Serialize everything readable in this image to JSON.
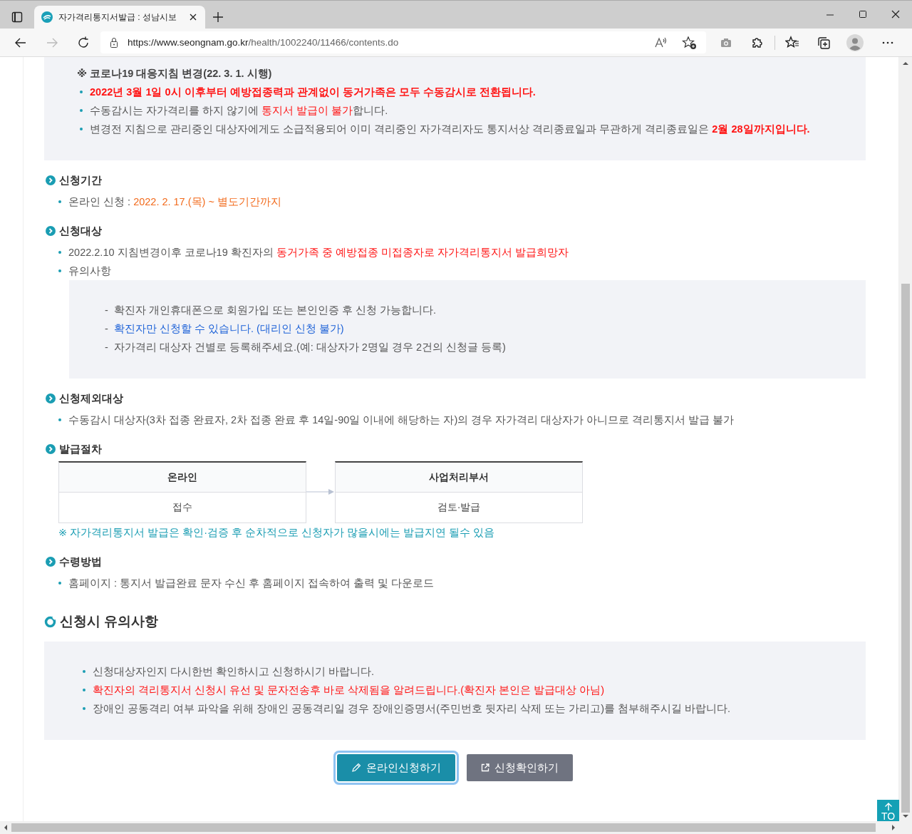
{
  "browser": {
    "tab_title": "자가격리통지서발급 : 성남시보",
    "url_host": "https://www.seongnam.go.kr",
    "url_path": "/health/1002240/11466/contents.do"
  },
  "notice": {
    "title": "※ 코로나19 대응지침 변경(22. 3. 1. 시행)",
    "items": [
      {
        "kind": "strong",
        "segments": [
          {
            "text": "2022년 3월 1일 0시 이후부터 예방접종력과 관계없이 동거가족은 모두 수동감시로 전환됩니다.",
            "color": "#ff1414"
          }
        ]
      },
      {
        "kind": "normal",
        "segments": [
          {
            "text": "수동감시는 자가격리를 하지 않기에 ",
            "color": "#555555"
          },
          {
            "text": "통지서 발급이 불가",
            "color": "#ff1414"
          },
          {
            "text": "합니다.",
            "color": "#555555"
          }
        ]
      },
      {
        "kind": "normal",
        "segments": [
          {
            "text": "변경전 지침으로 관리중인 대상자에게도 소급적용되어 이미 격리중인 자가격리자도 통지서상 격리종료일과 무관하게 격리종료일은 ",
            "color": "#555555"
          },
          {
            "text": "**2월 28일까지입니다.**",
            "color": "#ff1414"
          }
        ]
      }
    ]
  },
  "sections": [
    {
      "title": "신청기간",
      "body": [
        {
          "kind": "bullet",
          "segments": [
            {
              "text": "온라인 신청 : ",
              "color": "#555555"
            },
            {
              "text": "2022. 2. 17.(목) ~ 별도기간까지",
              "color": "#f26b1d"
            }
          ]
        }
      ]
    },
    {
      "title": "신청대상",
      "body": [
        {
          "kind": "bullet",
          "segments": [
            {
              "text": "2022.2.10 지침변경이후 코로나19 확진자의 ",
              "color": "#555555"
            },
            {
              "text": "동거가족 중 예방접종 미접종자로 자가격리통지서 발급희망자",
              "color": "#ff1414"
            }
          ]
        },
        {
          "kind": "bullet",
          "segments": [
            {
              "text": "유의사항",
              "color": "#555555"
            }
          ]
        },
        {
          "kind": "note_box",
          "lines": [
            {
              "marker": "-",
              "text": "확진자 개인휴대폰으로 회원가입 또는 본인인증 후 신청 가능합니다.",
              "color": "#555555"
            },
            {
              "marker": "-",
              "text": "확진자만 신청할 수 있습니다. (대리인 신청 불가)",
              "color": "#1f63d8"
            },
            {
              "marker": "-",
              "text": "자가격리 대상자 건별로 등록해주세요.(예: 대상자가 2명일 경우 2건의 신청글 등록)",
              "color": "#555555"
            }
          ]
        }
      ]
    },
    {
      "title": "신청제외대상",
      "body": [
        {
          "kind": "bullet",
          "segments": [
            {
              "text": "수동감시 대상자(3차 접종 완료자, 2차 접종 완료 후 14일-90일 이내에 해당하는 자)의 경우 자가격리 대상자가 아니므로 격리통지서 발급 불가",
              "color": "#555555"
            }
          ]
        }
      ]
    },
    {
      "title": "발급절차",
      "body": [
        {
          "kind": "flow",
          "steps": [
            {
              "header": "온라인",
              "body": "접수"
            },
            {
              "header": "사업처리부서",
              "body": "검토·발급"
            }
          ]
        },
        {
          "kind": "note",
          "text": "※ 자가격리통지서 발급은 확인·검증 후 순차적으로 신청자가 많을시에는 발급지연 될수 있음",
          "color": "#1a9db3"
        }
      ]
    },
    {
      "title": "수령방법",
      "body": [
        {
          "kind": "bullet",
          "segments": [
            {
              "text": "홈페이지 : 통지서 발급완료 문자 수신 후 홈페이지 접속하여 출력 및 다운로드",
              "color": "#555555"
            }
          ]
        }
      ]
    }
  ],
  "caution": {
    "title": "신청시 유의사항",
    "items": [
      {
        "segments": [
          {
            "text": "신청대상자인지 다시한번 확인하시고 신청하시기 바랍니다.",
            "color": "#555555"
          }
        ]
      },
      {
        "segments": [
          {
            "text": "확진자의 격리통지서 신청시 유선 및 문자전송후 바로 삭제됨을 알려드립니다.(확진자 본인은 발급대상 아님)",
            "color": "#ff1414"
          }
        ]
      },
      {
        "segments": [
          {
            "text": "장애인 공동격리 여부 파악을 위해 장애인 공동격리일 경우 장애인증명서(주민번호 뒷자리 삭제 또는 가리고)를 첨부해주시길 바랍니다.",
            "color": "#555555"
          }
        ]
      }
    ]
  },
  "buttons": [
    {
      "label": "온라인신청하기",
      "kind": "apply",
      "focused": true
    },
    {
      "label": "신청확인하기",
      "kind": "check",
      "focused": false
    }
  ],
  "top_button": {
    "label": "TO"
  }
}
